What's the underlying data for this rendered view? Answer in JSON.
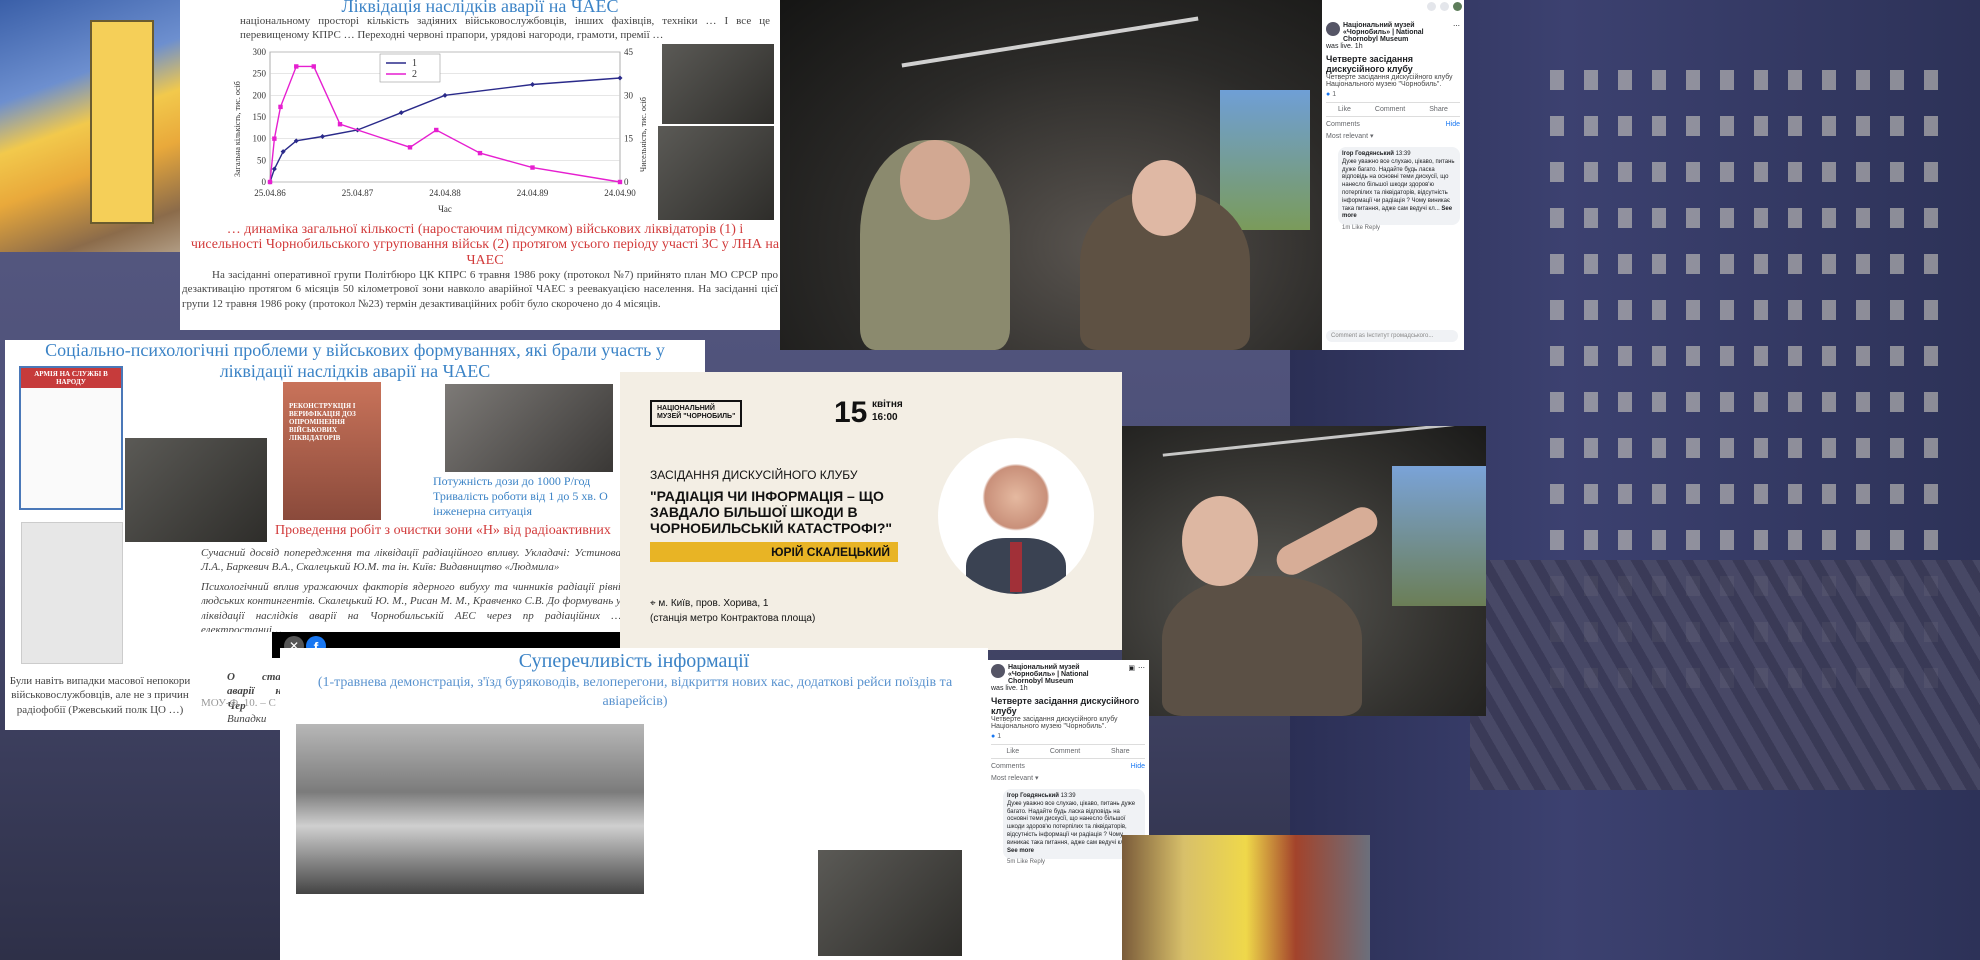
{
  "slide1": {
    "title": "Ліквідація наслідків аварії на ЧАЕС",
    "lead": "національному просторі кількість задіяних військовослужбовців, інших фахівців, техніки … І все це перевищеному КПРС … Переходні червоні прапори, урядові нагороди, грамоти, премії …",
    "caption": "… динаміка загальної кількості (наростаючим підсумком) військових ліквідаторів (1) і чисельності Чорнобильського угруповання військ (2) протягом усього періоду участі ЗС у ЛНА на ЧАЕС",
    "body": "На засіданні оперативної групи Політбюро ЦК КПРС 6 травня 1986 року (протокол №7) прийнято план МО СРСР про дезактивацію протягом 6 місяців 50 кілометрової зони навколо аварійної ЧАЕС з реевакуацією населення. На засіданні цієї групи 12 травня 1986 року (протокол №23) термін дезактиваційних робіт було скорочено до 4 місяців."
  },
  "chart_data": {
    "type": "line",
    "x": [
      "25.04.86",
      "25.04.87",
      "24.04.88",
      "24.04.89",
      "24.04.90"
    ],
    "ylim": [
      0,
      300
    ],
    "ylim_right": [
      0,
      45
    ],
    "ylabel": "Загальна кількість, тис. осіб",
    "ylabel_right": "Чисельність, тис. осіб",
    "xlabel": "Час",
    "series": [
      {
        "name": "1",
        "color": "#2a2a8a",
        "points": [
          [
            0,
            0
          ],
          [
            0.05,
            30
          ],
          [
            0.15,
            70
          ],
          [
            0.3,
            95
          ],
          [
            0.6,
            105
          ],
          [
            1.0,
            120
          ],
          [
            1.5,
            160
          ],
          [
            2.0,
            200
          ],
          [
            3.0,
            225
          ],
          [
            4.0,
            240
          ]
        ]
      },
      {
        "name": "2",
        "color": "#e61fd0",
        "points": [
          [
            0,
            0
          ],
          [
            0.05,
            15
          ],
          [
            0.12,
            26
          ],
          [
            0.3,
            40
          ],
          [
            0.5,
            40
          ],
          [
            0.8,
            20
          ],
          [
            1.6,
            12
          ],
          [
            1.9,
            18
          ],
          [
            2.4,
            10
          ],
          [
            3.0,
            5
          ],
          [
            4.0,
            0
          ]
        ]
      }
    ],
    "yticks": [
      0,
      50,
      100,
      150,
      200,
      250,
      300
    ],
    "yticks_right": [
      0,
      15,
      30,
      45
    ]
  },
  "fb1": {
    "page": "Національний музей «Чорнобиль» | National Chornobyl Museum",
    "status": "was live.",
    "time": "1h",
    "title": "Четверте засідання дискусійного клубу",
    "desc": "Четверте засідання дискусійного клубу Національного музею \"Чорнобиль\".",
    "stats": "1",
    "like": "Like",
    "comment": "Comment",
    "share": "Share",
    "comments_label": "Comments",
    "hide": "Hide",
    "most_relevant": "Most relevant ▾",
    "commenter": "Ігор Говдянський",
    "comment_time": "13:39",
    "comment_text": "Дуже уважно все слухаю, цікаво, питань дуже багато. Надайте будь ласка відповідь на основні теми дискусії, що нанесло більшої шкоди здоров'ю потерпілих та ліквідаторів, відсутність інформації чи радіація ? Чому виникає така питання, адже сам ведучі кл...",
    "see_more": "See more",
    "reply_row": "1m   Like   Reply",
    "write_placeholder": "Comment as Інститут громадського..."
  },
  "slide2": {
    "title": "Соціально-психологічні проблеми у військових формуваннях, які брали участь у ліквідації наслідків аварії на ЧАЕС",
    "book1": "АРМІЯ НА СЛУЖБІ В НАРОДУ",
    "book2": "РЕКОНСТРУКЦІЯ І ВЕРИФІКАЦІЯ ДОЗ ОПРОМІНЕННЯ ВІЙСЬКОВИХ ЛІКВІДАТОРІВ",
    "dose": "Потужність дози до 1000 Р/год",
    "duration": "Тривалість роботи від 1 до 5 хв. О",
    "engineering": "інженерна ситуація",
    "red_line": "Проведення робіт з очистки зони «Н» від радіоактивних",
    "modern": "Сучасний досвід попередження та ліквідації радіаційного впливу. Укладачі: Устинова Л.А., Баркевич В.А., Скалецький Ю.М. та ін. Київ: Видавництво «Людмила»",
    "psych": "Психологічний вплив уражаючих факторів ядерного вибуху та чинників радіації рівні людських контингентів. Скалецький Ю. М., Рисан М. М., Кравченко С.В. До формувань у ліквідації наслідків аварії на Чорнобильській АЕС через пр радіаційних … електростанці…",
    "left_note": "Були навіть випадки масової непокори військовослужбовців, але не з причин радіофобії (Ржевський полк ЦО …)",
    "state": "О стан аварії на Чер",
    "mou": "МОУ-Ф. 10. – С",
    "cases": "Випадки"
  },
  "poster": {
    "logo_line1": "НАЦІОНАЛЬНИЙ",
    "logo_line2": "МУЗЕЙ \"ЧОРНОБИЛЬ\"",
    "day": "15",
    "month": "квітня",
    "time": "16:00",
    "club": "ЗАСІДАННЯ ДИСКУСІЙНОГО КЛУБУ",
    "topic": "\"РАДІАЦІЯ ЧИ ІНФОРМАЦІЯ – ЩО ЗАВДАЛО БІЛЬШОЇ ШКОДИ В ЧОРНОБИЛЬСЬКІЙ КАТАСТРОФІ?\"",
    "speaker": "ЮРІЙ СКАЛЕЦЬКИЙ",
    "address1": "м. Київ, пров. Хорива, 1",
    "address2": "(станція метро Контрактова площа)"
  },
  "slide3": {
    "title": "Суперечливість інформації",
    "subtitle": "(1-травнева демонстрація, з'їзд буряководів, велоперегони, відкриття нових кас, додаткові рейси поїздів та авіарейсів)"
  },
  "fb2": {
    "page": "Національний музей «Чорнобиль» | National Chornobyl Museum",
    "status": "was live.",
    "time": "1h",
    "title": "Четверте засідання дискусійного клубу",
    "desc": "Четверте засідання дискусійного клубу Національного музею \"Чорнобиль\".",
    "stats": "1",
    "like": "Like",
    "comment": "Comment",
    "share": "Share",
    "comments_label": "Comments",
    "hide": "Hide",
    "most_relevant": "Most relevant ▾",
    "commenter": "Ігор Говдянський",
    "comment_time": "13:39",
    "comment_text": "Дуже уважно все слухаю, цікаво, питань дуже багато. Надайте будь ласка відповідь на основні теми дискусії, що нанесло більшої шкоди здоров'ю потерпілих та ліквідаторів, відсутність інформації чи радіація ? Чому виникає така питання, адже сам ведучі кл...",
    "see_more": "See more",
    "reply_row": "5m   Like   Reply"
  },
  "colors": {
    "fb_blue": "#1877f2",
    "slide_blue": "#3b83c6",
    "slide_red": "#d23b3b",
    "poster_yellow": "#e8b425"
  },
  "icons": [
    "facebook-icon",
    "close-icon",
    "more-icon",
    "save-icon",
    "like-icon",
    "comment-icon",
    "share-icon"
  ]
}
